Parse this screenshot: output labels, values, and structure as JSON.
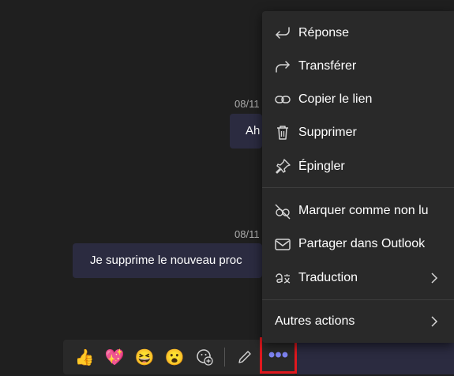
{
  "chat": {
    "messages": [
      {
        "timestamp": "08/11",
        "text": "Ah"
      },
      {
        "timestamp": "08/11",
        "text": "Je supprime le nouveau proc"
      }
    ]
  },
  "reactions": [
    {
      "icon": "thumbs-up-icon",
      "glyph": "👍"
    },
    {
      "icon": "heart-icon",
      "glyph": "💖"
    },
    {
      "icon": "laughing-face-icon",
      "glyph": "😆"
    },
    {
      "icon": "surprised-face-icon",
      "glyph": "😮"
    }
  ],
  "toolbar": {
    "more_label": "•••"
  },
  "menu": {
    "items": [
      {
        "label": "Réponse",
        "icon": "reply-icon"
      },
      {
        "label": "Transférer",
        "icon": "forward-icon"
      },
      {
        "label": "Copier le lien",
        "icon": "link-icon"
      },
      {
        "label": "Supprimer",
        "icon": "trash-icon"
      },
      {
        "label": "Épingler",
        "icon": "pin-icon"
      },
      {
        "label": "Marquer comme non lu",
        "icon": "mark-unread-icon"
      },
      {
        "label": "Partager dans Outlook",
        "icon": "mail-icon"
      },
      {
        "label": "Traduction",
        "icon": "translate-icon"
      }
    ],
    "more_actions_label": "Autres actions"
  },
  "colors": {
    "background": "#1f1f1f",
    "menu_bg": "#292929",
    "bubble_bg": "#2b2b40",
    "accent": "#7f85f5",
    "highlight": "#e0181e"
  }
}
